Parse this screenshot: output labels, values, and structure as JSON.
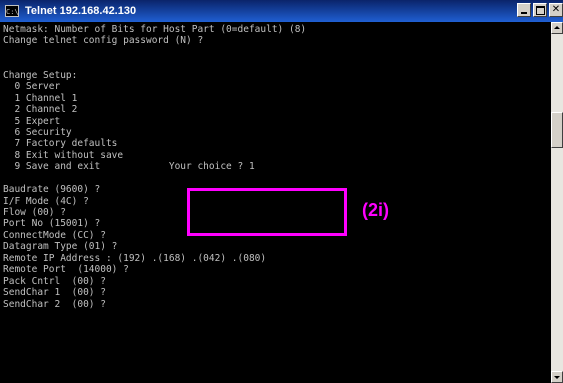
{
  "window": {
    "title": "Telnet 192.168.42.130",
    "icon": "console-icon"
  },
  "terminal": {
    "lines": [
      "Netmask: Number of Bits for Host Part (0=default) (8)",
      "Change telnet config password (N) ?",
      "",
      "",
      "Change Setup:",
      "  0 Server",
      "  1 Channel 1",
      "  2 Channel 2",
      "  5 Expert",
      "  6 Security",
      "  7 Factory defaults",
      "  8 Exit without save",
      "  9 Save and exit            Your choice ? 1",
      "",
      "Baudrate (9600) ?",
      "I/F Mode (4C) ?",
      "Flow (00) ?",
      "Port No (15001) ?",
      "ConnectMode (CC) ?",
      "Datagram Type (01) ?",
      "Remote IP Address : (192) .(168) .(042) .(080)",
      "Remote Port  (14000) ?",
      "Pack Cntrl  (00) ?",
      "SendChar 1  (00) ?",
      "SendChar 2  (00) ?"
    ]
  },
  "callout": {
    "label": "(2i)",
    "color": "#ff00ff"
  }
}
